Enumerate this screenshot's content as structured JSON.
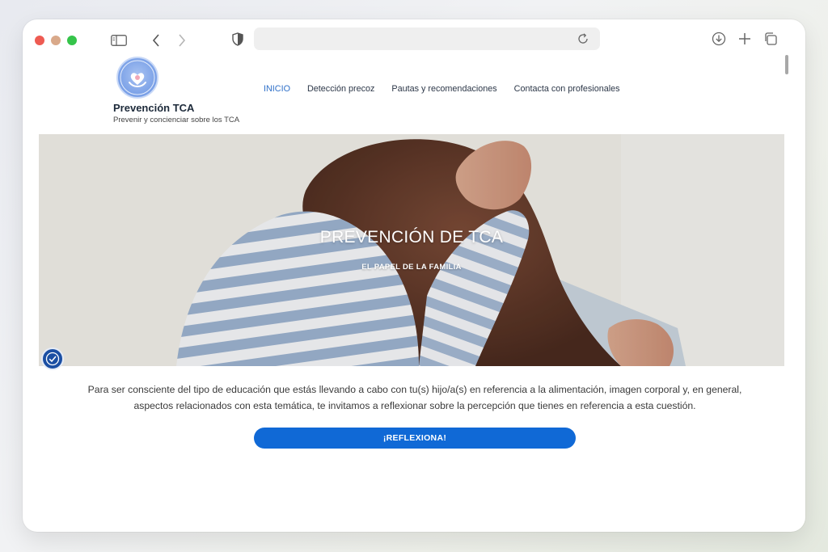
{
  "browser": {
    "url": "",
    "icons": [
      "sidebar-icon",
      "back-icon",
      "forward-icon",
      "shield-icon",
      "reload-icon",
      "download-icon",
      "plus-icon",
      "tabs-icon"
    ]
  },
  "site": {
    "title": "Prevención TCA",
    "tagline": "Prevenir y concienciar sobre los TCA",
    "logo_text": "Prevención",
    "logo_small": "TCA"
  },
  "nav": {
    "items": [
      {
        "label": "INICIO",
        "active": true
      },
      {
        "label": "Detección precoz",
        "active": false
      },
      {
        "label": "Pautas y recomendaciones",
        "active": false
      },
      {
        "label": "Contacta con profesionales",
        "active": false
      }
    ]
  },
  "hero": {
    "title": "PREVENCIÓN DE TCA",
    "subtitle": "EL PAPEL DE LA FAMILIA"
  },
  "intro": {
    "text": "Para ser consciente del tipo de educación que estás llevando a cabo con tu(s) hijo/a(s) en referencia a la alimentación, imagen corporal y, en general, aspectos relacionados con esta temática, te invitamos a reflexionar sobre la percepción que tienes en referencia a esta cuestión."
  },
  "cta": {
    "label": "¡REFLEXIONA!"
  },
  "colors": {
    "accent": "#1069d6",
    "nav_active": "#2f70c9",
    "a11y_badge": "#1b4fa3"
  }
}
